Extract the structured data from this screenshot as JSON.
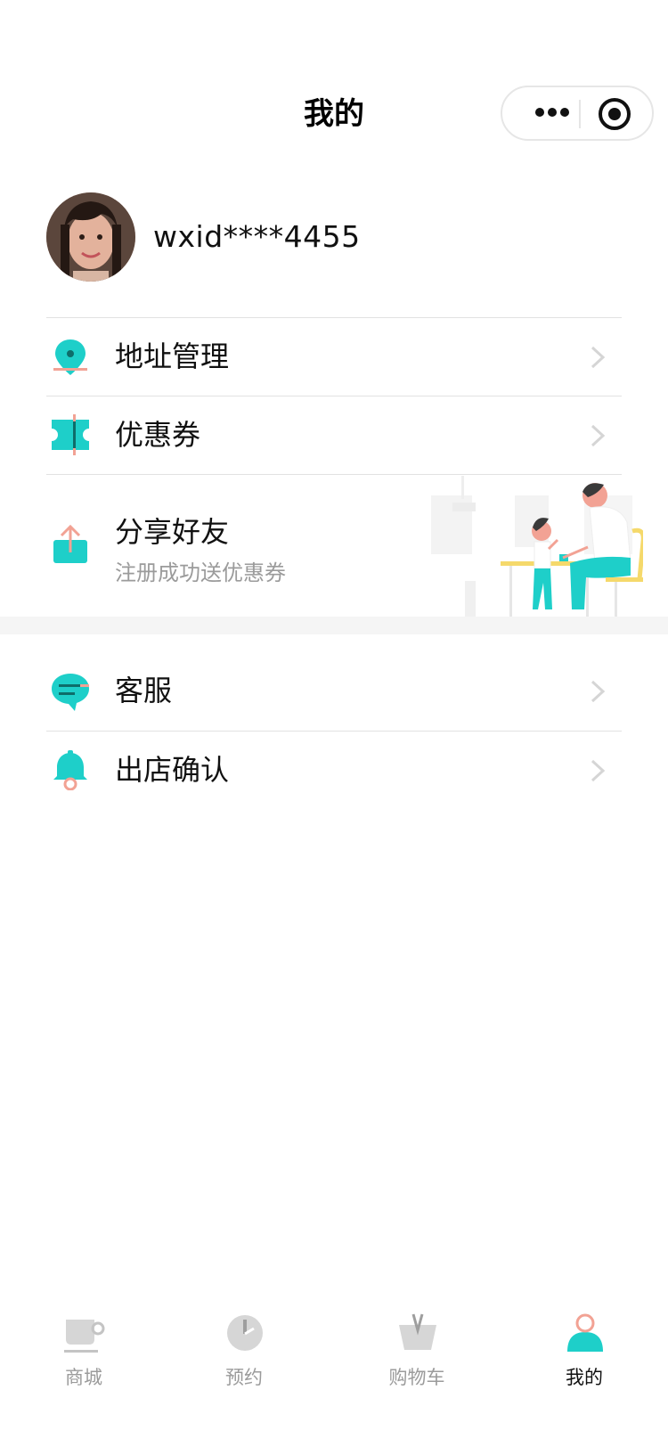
{
  "header": {
    "title": "我的",
    "menu_icon": "more-dots-icon",
    "close_icon": "target-circle-icon"
  },
  "profile": {
    "username": "wxid****4455"
  },
  "menu": {
    "address": "地址管理",
    "coupon": "优惠券",
    "share_title": "分享好友",
    "share_subtitle": "注册成功送优惠券",
    "service": "客服",
    "checkout_confirm": "出店确认"
  },
  "tabbar": {
    "items": [
      {
        "label": "商城",
        "icon": "coffee-cup-icon"
      },
      {
        "label": "预约",
        "icon": "clock-icon"
      },
      {
        "label": "购物车",
        "icon": "basket-icon"
      },
      {
        "label": "我的",
        "icon": "user-icon",
        "active": true
      }
    ]
  },
  "colors": {
    "accent": "#1ecfc9",
    "secondary": "#f2a294",
    "chevron": "#d5d5d5",
    "inactive_tab": "#cfcfcf",
    "band": "#f5f5f5"
  }
}
